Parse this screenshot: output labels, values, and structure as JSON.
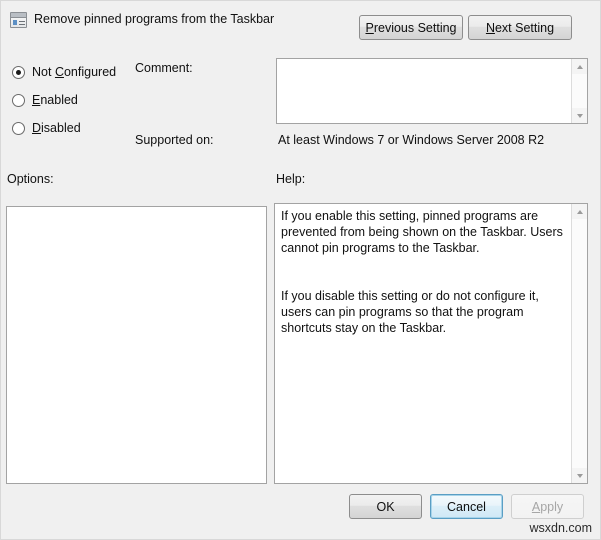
{
  "dialog": {
    "title": "Remove pinned programs from the Taskbar",
    "icon": "policy-setting-icon"
  },
  "nav": {
    "previous_setting": "Previous Setting",
    "previous_setting_accel": "P",
    "previous_setting_rest": "revious Setting",
    "next_setting": "Next Setting",
    "next_setting_accel": "N",
    "next_setting_rest": "ext Setting"
  },
  "state_options": {
    "selected": "Not Configured",
    "items": [
      {
        "label": "Not Configured",
        "pre": "Not ",
        "accel": "C",
        "post": "onfigured",
        "checked": true
      },
      {
        "label": "Enabled",
        "pre": "",
        "accel": "E",
        "post": "nabled",
        "checked": false
      },
      {
        "label": "Disabled",
        "pre": "",
        "accel": "D",
        "post": "isabled",
        "checked": false
      }
    ]
  },
  "fields": {
    "comment_label": "Comment:",
    "comment_value": "",
    "supported_on_label": "Supported on:",
    "supported_on_value": "At least Windows 7 or Windows Server 2008 R2",
    "options_label": "Options:",
    "options_value": "",
    "help_label": "Help:",
    "help_value": "If you enable this setting, pinned programs are prevented from being shown on the Taskbar. Users cannot pin programs to the Taskbar.\n\n\nIf you disable this setting or do not configure it, users can pin programs so that the program shortcuts stay on the Taskbar."
  },
  "footer": {
    "ok": "OK",
    "cancel": "Cancel",
    "apply": "Apply",
    "apply_accel": "A",
    "apply_rest": "pply",
    "apply_disabled": true,
    "cancel_focused": true
  },
  "watermark": "wsxdn.com",
  "colors": {
    "dialog_background": "#f0f0f0",
    "field_background": "#ffffff",
    "text": "#111111",
    "disabled_text": "#a6a6a6",
    "focus_border": "#5a9ec4",
    "border": "#a3a3a3"
  }
}
